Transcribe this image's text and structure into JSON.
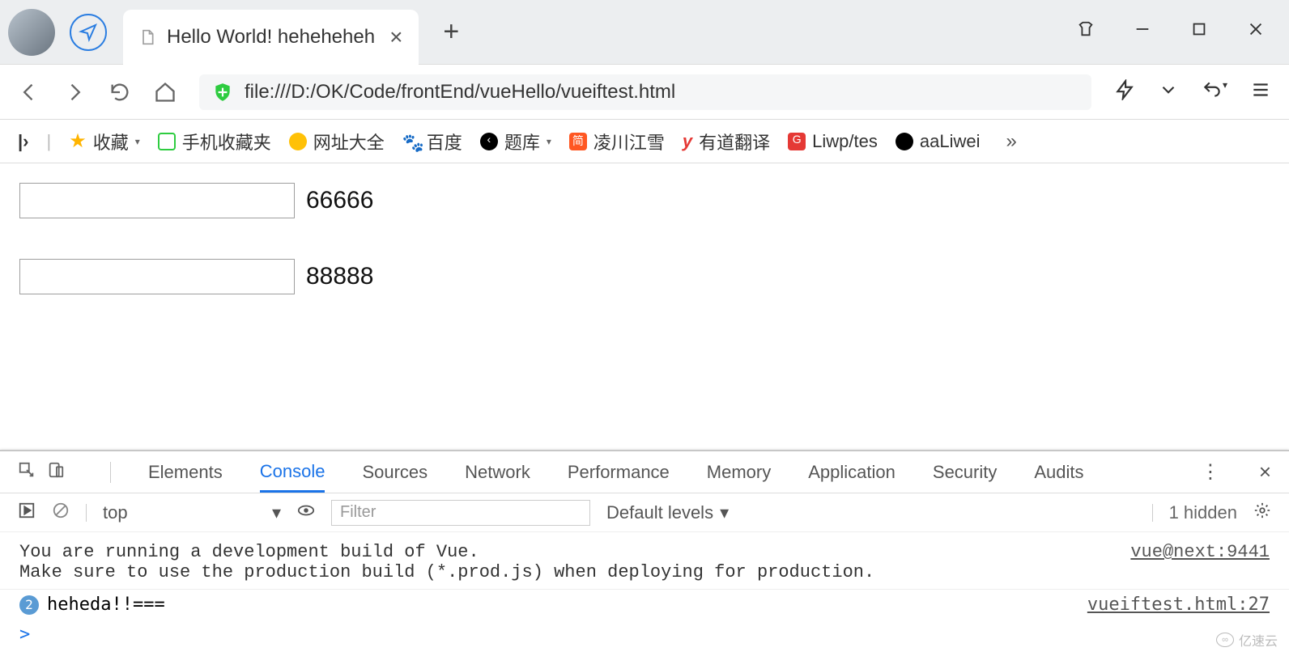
{
  "window": {
    "tab_title": "Hello World! heheheheh",
    "url": "file:///D:/OK/Code/frontEnd/vueHello/vueiftest.html"
  },
  "bookmarks": {
    "fav_label": "收藏",
    "mobile_fav": "手机收藏夹",
    "wzdq": "网址大全",
    "baidu": "百度",
    "tiku": "题库",
    "lcjx": "凌川江雪",
    "youdao": "有道翻译",
    "liwp": "Liwp/tes",
    "aaliwei": "aaLiwei"
  },
  "page": {
    "rows": [
      {
        "input_value": "",
        "text": "66666"
      },
      {
        "input_value": "",
        "text": "88888"
      }
    ]
  },
  "devtools": {
    "tabs": [
      "Elements",
      "Console",
      "Sources",
      "Network",
      "Performance",
      "Memory",
      "Application",
      "Security",
      "Audits"
    ],
    "active_tab": "Console",
    "context": "top",
    "filter_placeholder": "Filter",
    "levels_label": "Default levels",
    "hidden_label": "1 hidden",
    "messages": {
      "warn_line1": "You are running a development build of Vue.",
      "warn_line2": "Make sure to use the production build (*.prod.js) when deploying for production.",
      "warn_src": "vue@next:9441",
      "badge_count": "2",
      "log_text": "heheda!!===",
      "log_src": "vueiftest.html:27"
    },
    "prompt": ">"
  },
  "watermark": "亿速云"
}
